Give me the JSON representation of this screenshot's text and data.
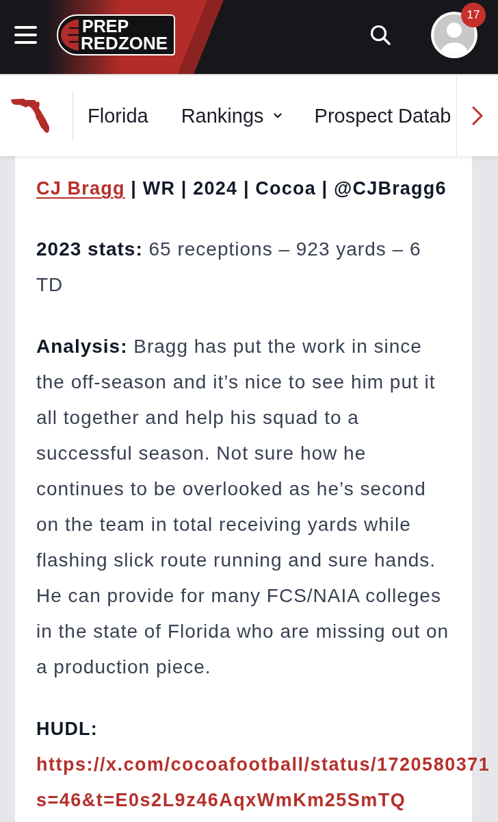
{
  "header": {
    "notification_count": "17"
  },
  "logo": {
    "line_1": "PREP",
    "line_2": "REDZONE"
  },
  "nav": {
    "items": [
      {
        "label": "Florida",
        "has_dropdown": false
      },
      {
        "label": "Rankings",
        "has_dropdown": true
      },
      {
        "label": "Prospect Datab",
        "has_dropdown": false
      }
    ]
  },
  "article": {
    "heading": {
      "link": "CJ Bragg",
      "rest": "| WR | 2024 | Cocoa | @CJBragg6"
    },
    "paragraphs": [
      "**2023 stats:** 65 receptions – 923 yards – 6 TD",
      "**Analysis:** Bragg has put the work in since the off-season and it’s nice to see him put it all together and help his squad to a successful season. Not sure how he continues to be overlooked as he’s second on the team in total receiving yards while flashing slick route running and sure hands. He can provide for many FCS/NAIA colleges in the state of Florida who are missing out on a production piece."
    ],
    "hudl": {
      "label": "HUDL:",
      "link_lines": [
        "https://x.com/cocoafootball/status/1720580371",
        "s=46&t=E0s2L9z46AqxWmKm25SmTQ"
      ]
    }
  }
}
